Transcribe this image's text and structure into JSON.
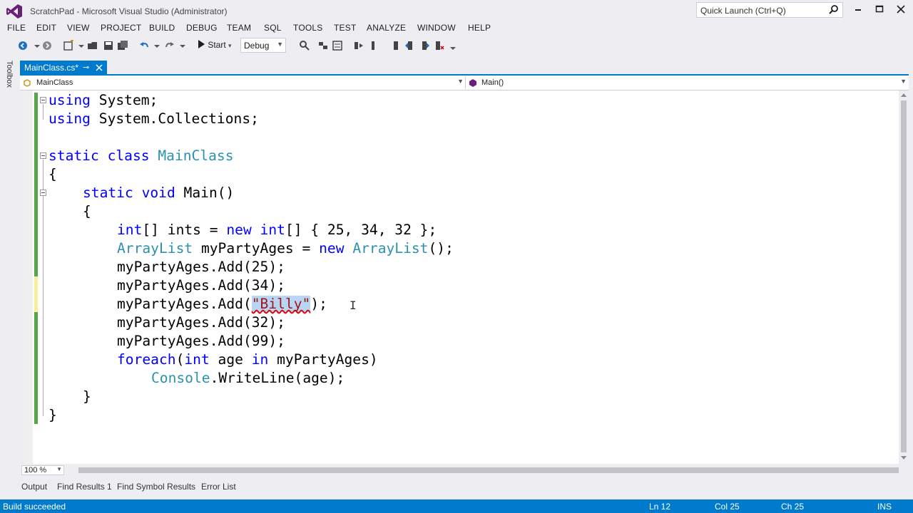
{
  "window": {
    "title": "ScratchPad - Microsoft Visual Studio (Administrator)",
    "quick_launch_placeholder": "Quick Launch (Ctrl+Q)"
  },
  "menu": [
    "FILE",
    "EDIT",
    "VIEW",
    "PROJECT",
    "BUILD",
    "DEBUG",
    "TEAM",
    "SQL",
    "TOOLS",
    "TEST",
    "ANALYZE",
    "WINDOW",
    "HELP"
  ],
  "toolbar": {
    "start_label": "Start",
    "configuration": "Debug"
  },
  "toolbox_label": "Toolbox",
  "document_tab": {
    "label": "MainClass.cs*"
  },
  "navbar": {
    "left": "MainClass",
    "right": "Main()"
  },
  "code": {
    "line1": [
      "using",
      " System;"
    ],
    "line2": [
      "using",
      " System.Collections;"
    ],
    "line4": [
      "static class ",
      "MainClass"
    ],
    "line5": "{",
    "line6": [
      "static void",
      " Main()"
    ],
    "line7": "{",
    "line8": [
      "int",
      "[] ints = ",
      "new",
      " ",
      "int",
      "[] { 25, 34, 32 };"
    ],
    "line9": [
      "ArrayList",
      " myPartyAges = ",
      "new",
      " ",
      "ArrayList",
      "();"
    ],
    "line10": "myPartyAges.Add(25);",
    "line11": "myPartyAges.Add(34);",
    "line12": [
      "myPartyAges.Add(",
      "\"Billy\"",
      ");"
    ],
    "line13": "myPartyAges.Add(32);",
    "line14": "myPartyAges.Add(99);",
    "line15": [
      "foreach",
      "(",
      "int",
      " age ",
      "in",
      " myPartyAges)"
    ],
    "line16": [
      "Console",
      ".WriteLine(age);"
    ],
    "line17": "}",
    "line18": "}"
  },
  "zoom": "100 %",
  "output_tabs": [
    "Output",
    "Find Results 1",
    "Find Symbol Results",
    "Error List"
  ],
  "status": {
    "message": "Build succeeded",
    "ln": "Ln 12",
    "col": "Col 25",
    "ch": "Ch 25",
    "mode": "INS"
  },
  "colors": {
    "accent": "#007acc",
    "keyword": "#0000ff",
    "type": "#2b91af",
    "string": "#a31515"
  }
}
